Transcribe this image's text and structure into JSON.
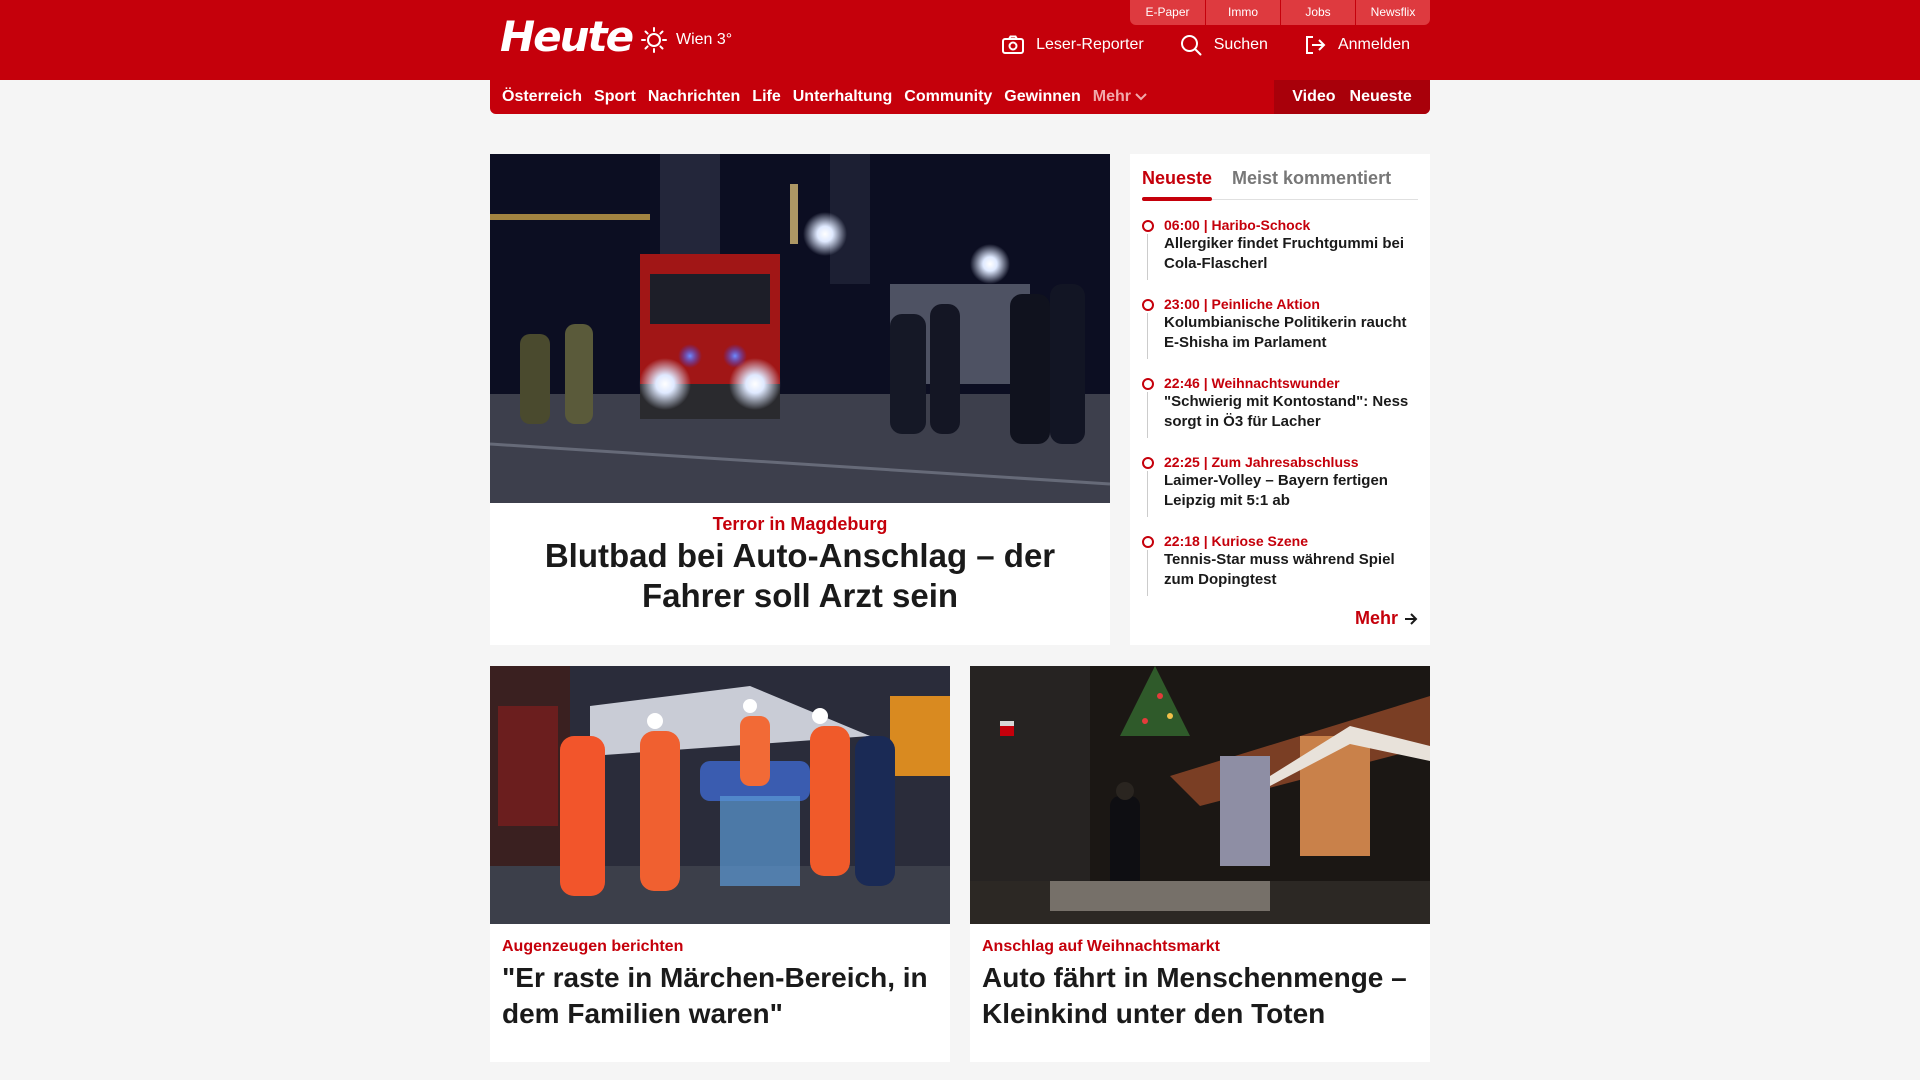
{
  "header": {
    "logo": "Heute",
    "weather": "Wien 3°",
    "top_links": [
      "E-Paper",
      "Immo",
      "Jobs",
      "Newsflix"
    ],
    "actions": {
      "reporter": "Leser-Reporter",
      "search": "Suchen",
      "login": "Anmelden"
    }
  },
  "nav": {
    "items": [
      "Österreich",
      "Sport",
      "Nachrichten",
      "Life",
      "Unterhaltung",
      "Community",
      "Gewinnen"
    ],
    "more": "Mehr",
    "right": [
      "Video",
      "Neueste"
    ]
  },
  "hero": {
    "kicker": "Terror in Magdeburg",
    "title": "Blutbad bei Auto-Anschlag – der Fahrer soll Arzt sein"
  },
  "sidebar": {
    "tabs": [
      "Neueste",
      "Meist kommentiert"
    ],
    "items": [
      {
        "meta": "06:00 | Haribo-Schock",
        "title": "Allergiker findet Fruchtgummi bei Cola-Flascherl"
      },
      {
        "meta": "23:00 | Peinliche Aktion",
        "title": "Kolumbianische Politikerin raucht E-Shisha im Parlament"
      },
      {
        "meta": "22:46 | Weihnachtswunder",
        "title": "\"Schwierig mit Kontostand\": Ness sorgt in Ö3 für Lacher"
      },
      {
        "meta": "22:25 | Zum Jahresabschluss",
        "title": "Laimer-Volley – Bayern fertigen Leipzig mit 5:1 ab"
      },
      {
        "meta": "22:18 | Kuriose Szene",
        "title": "Tennis-Star muss während Spiel zum Dopingtest"
      }
    ],
    "more": "Mehr"
  },
  "cards": [
    {
      "kicker": "Augenzeugen berichten",
      "title": "\"Er raste in Märchen-Bereich, in dem Familien waren\""
    },
    {
      "kicker": "Anschlag auf Weihnachtsmarkt",
      "title": "Auto fährt in Menschenmenge – Kleinkind unter den Toten"
    }
  ],
  "colors": {
    "brand": "#c5000b",
    "brand_dark": "#a8000a",
    "background": "#f5f5f5"
  }
}
